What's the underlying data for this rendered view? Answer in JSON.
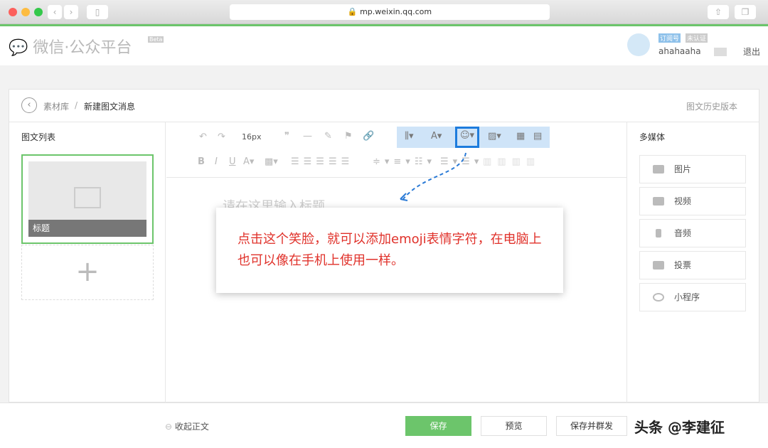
{
  "browser": {
    "url": "mp.weixin.qq.com"
  },
  "header": {
    "logo": "微信·公众平台",
    "beta": "Beta",
    "badge_type": "订阅号",
    "badge_status": "未认证",
    "username": "ahahaaha",
    "logout": "退出"
  },
  "breadcrumb": {
    "parent": "素材库",
    "sep": "/",
    "current": "新建图文消息",
    "history": "图文历史版本"
  },
  "left": {
    "title": "图文列表",
    "card_title": "标题",
    "add": "+"
  },
  "toolbar": {
    "font_size": "16px"
  },
  "editor": {
    "title_placeholder": "请在这里输入标题"
  },
  "right": {
    "title": "多媒体",
    "items": [
      "图片",
      "视频",
      "音频",
      "投票",
      "小程序"
    ]
  },
  "popup": {
    "text": "点击这个笑脸，就可以添加emoji表情字符，在电脑上也可以像在手机上使用一样。"
  },
  "footer": {
    "collapse": "收起正文",
    "save": "保存",
    "preview": "预览",
    "save_send": "保存并群发"
  },
  "watermark": "头条 @李建征",
  "colors": {
    "accent": "#6cc56b",
    "highlight": "#1d7cdd",
    "popup_text": "#e0322b"
  }
}
